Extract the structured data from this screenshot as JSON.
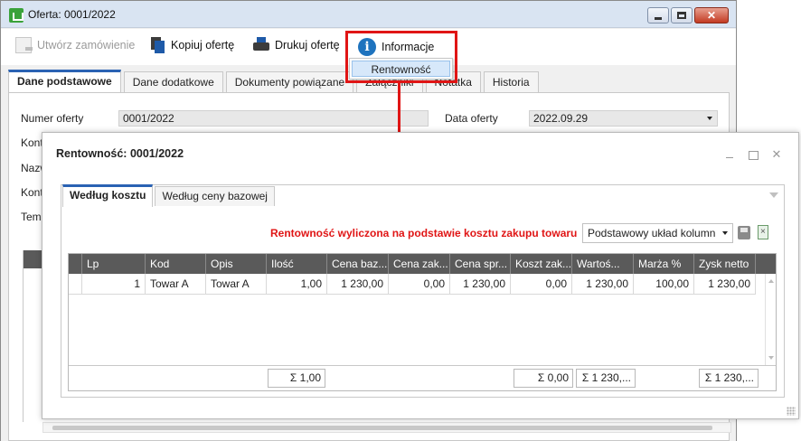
{
  "window": {
    "title": "Oferta: 0001/2022"
  },
  "toolbar": {
    "create_order": "Utwórz zamówienie",
    "copy_offer": "Kopiuj ofertę",
    "print_offer": "Drukuj ofertę",
    "info": "Informacje"
  },
  "info_menu": {
    "items": [
      "Rentowność"
    ]
  },
  "tabs": [
    "Dane podstawowe",
    "Dane dodatkowe",
    "Dokumenty powiązane",
    "Załączniki",
    "Notatka",
    "Historia"
  ],
  "form": {
    "offer_number_label": "Numer oferty",
    "offer_number_value": "0001/2022",
    "offer_date_label": "Data oferty",
    "offer_date_value": "2022.09.29",
    "partial_labels": [
      "Kont",
      "Nazw",
      "Kont",
      "Tema"
    ]
  },
  "dialog": {
    "title": "Rentowność: 0001/2022",
    "tabs": [
      "Według kosztu",
      "Według ceny bazowej"
    ],
    "info_text": "Rentowność wyliczona na podstawie kosztu zakupu towaru",
    "layout_select": "Podstawowy układ kolumn",
    "columns": [
      "Lp",
      "Kod",
      "Opis",
      "Ilość",
      "Cena baz...",
      "Cena zak...",
      "Cena spr...",
      "Koszt zak...",
      "Wartoś...",
      "Marża %",
      "Zysk netto"
    ],
    "rows": [
      [
        "1",
        "Towar A",
        "Towar A",
        "1,00",
        "1 230,00",
        "0,00",
        "1 230,00",
        "0,00",
        "1 230,00",
        "100,00",
        "1 230,00"
      ]
    ],
    "sums": {
      "qty": "Σ  1,00",
      "cost": "Σ  0,00",
      "value": "Σ  1 230,...",
      "profit": "Σ  1 230,..."
    }
  },
  "colors": {
    "accent_blue": "#2a62b3",
    "highlight_red": "#e01515",
    "grid_header": "#5a5a5a"
  }
}
